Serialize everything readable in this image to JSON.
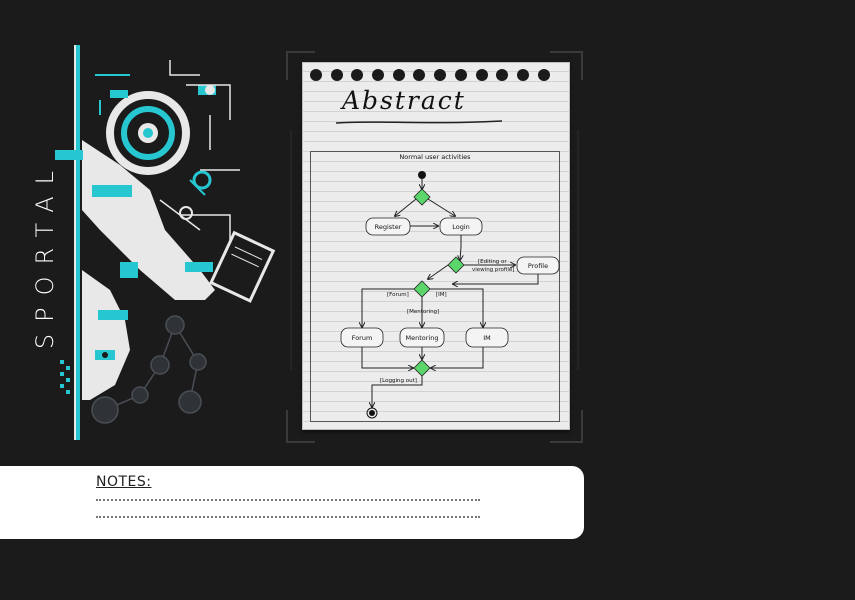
{
  "brand": {
    "name": "SPORTAL"
  },
  "notebook": {
    "heading": "Abstract"
  },
  "diagram": {
    "title": "Normal user activities",
    "nodes": {
      "register": "Register",
      "login": "Login",
      "profile": "Profile",
      "forum": "Forum",
      "mentoring": "Mentoring",
      "im": "IM"
    },
    "guards": {
      "editing_line1": "[Editing or",
      "editing_line2": "viewing profile]",
      "forum": "[Forum]",
      "im": "[IM]",
      "mentoring": "[Mentoring]",
      "logout": "[Logging out]"
    }
  },
  "notes": {
    "title": "NOTES:"
  },
  "colors": {
    "background": "#1b1b1b",
    "accent": "#27c7d2",
    "decision": "#5bd66a"
  }
}
